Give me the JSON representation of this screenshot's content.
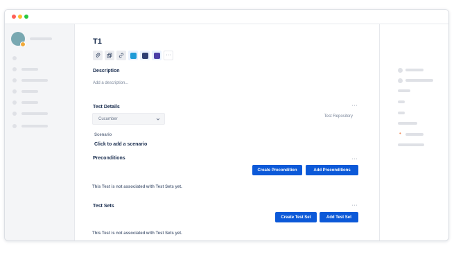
{
  "issue": {
    "key": "T1",
    "description_heading": "Description",
    "description_placeholder": "Add a description..."
  },
  "toolbar": {
    "icons": [
      "paperclip-icon",
      "clone-icon",
      "link-icon",
      "app-blue-icon",
      "app-navy-icon",
      "app-purple-icon",
      "more-icon"
    ],
    "more_label": "···"
  },
  "test_details": {
    "heading": "Test Details",
    "more_label": "···",
    "test_type": "Cucumber",
    "repository_label": "Test Repository",
    "scenario_label": "Scenario",
    "scenario_placeholder": "Click to add a scenario"
  },
  "preconditions": {
    "heading": "Preconditions",
    "more_label": "···",
    "create_button": "Create Precondition",
    "add_button": "Add Preconditions",
    "empty_message": "This Test is not associated with Test Sets yet."
  },
  "test_sets": {
    "heading": "Test Sets",
    "more_label": "···",
    "create_button": "Create Test Set",
    "add_button": "Add Test Set",
    "empty_message": "This Test is not associated with Test Sets yet."
  },
  "colors": {
    "primary_button": "#0c59d8",
    "sidebar_bg": "#f4f5f7",
    "avatar": "#79a8b1",
    "avatar_badge": "#f0a93b",
    "traffic_red": "#ff5f57",
    "traffic_yellow": "#febc2e",
    "traffic_green": "#28c840"
  }
}
